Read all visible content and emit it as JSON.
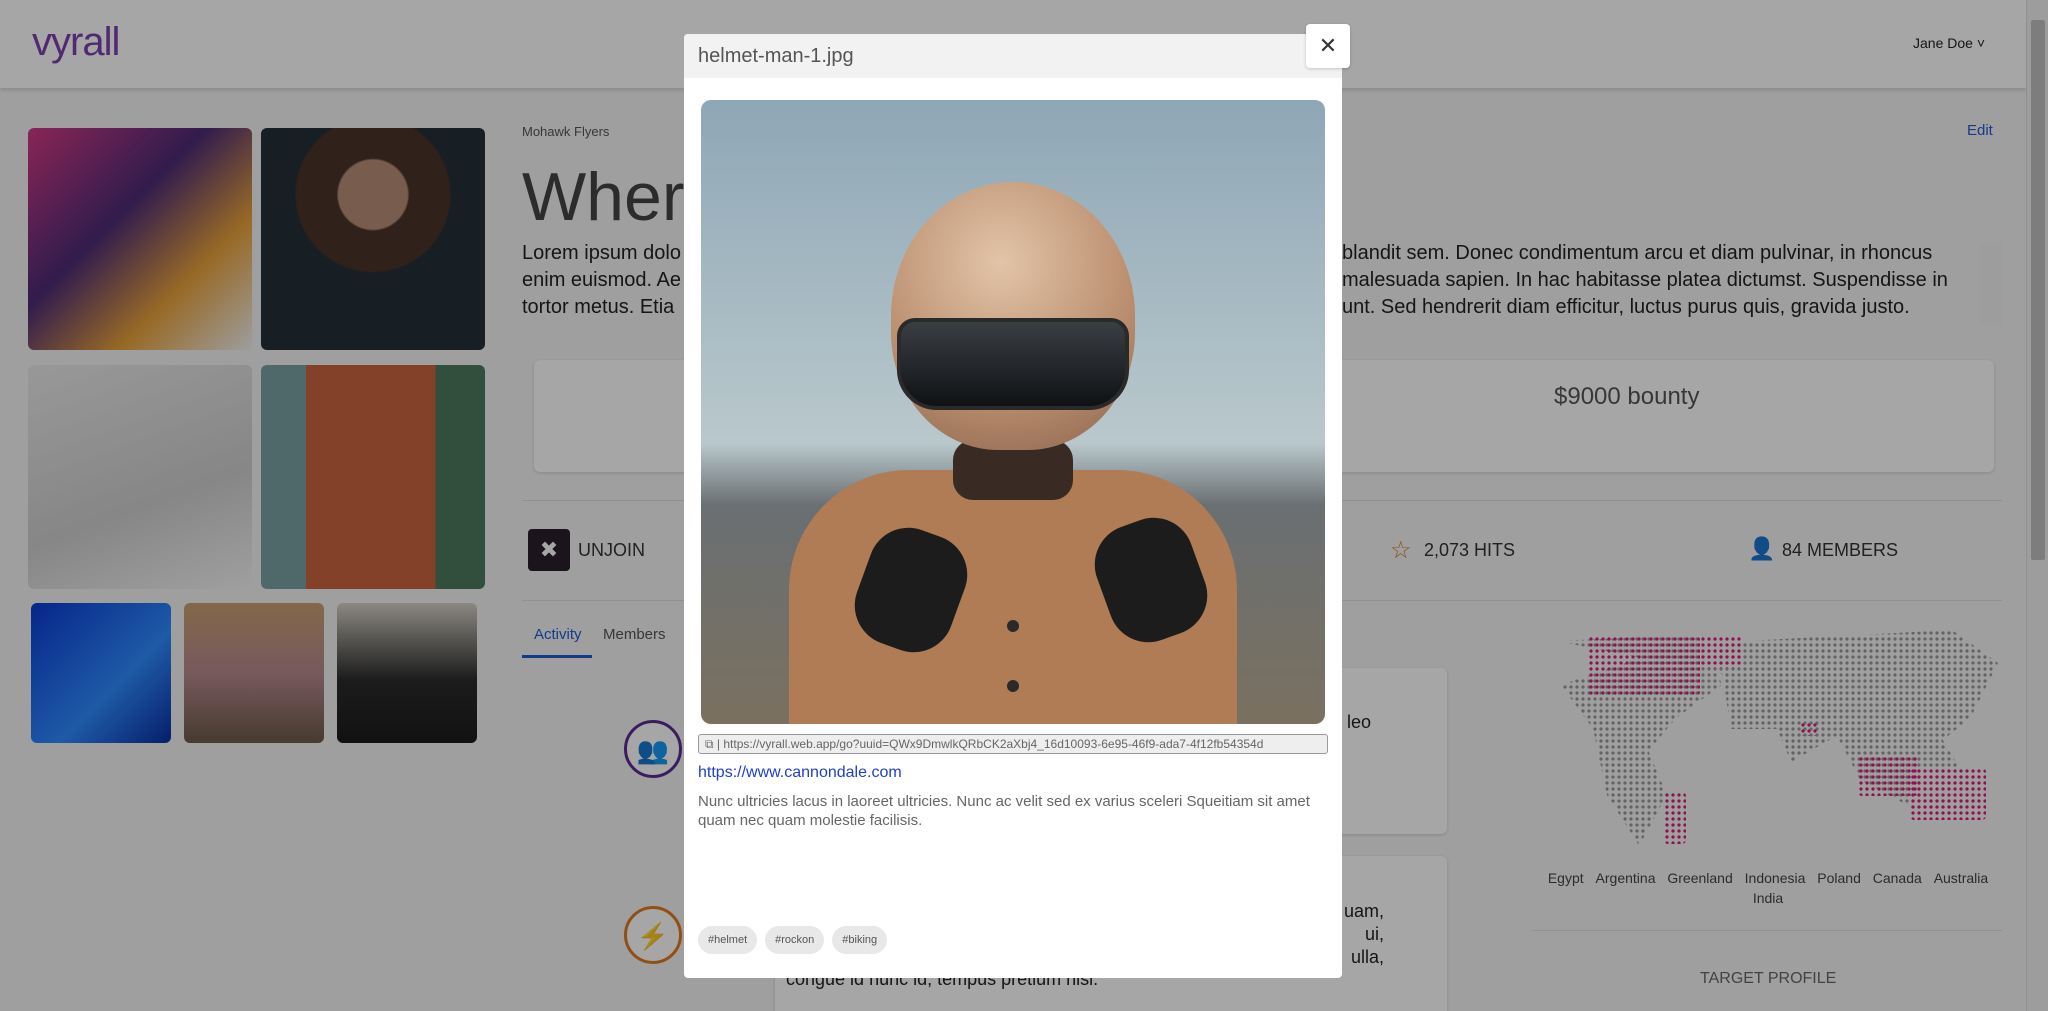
{
  "header": {
    "logo": "vyrall",
    "user": "Jane Doe ˅"
  },
  "page": {
    "breadcrumb": "Mohawk Flyers",
    "edit": "Edit",
    "title": "Where",
    "description_left": "Lorem ipsum dolo\nenim euismod. Ae\ntortor metus. Etia",
    "description_right": "blandit sem. Donec condimentum arcu et diam pulvinar, in rhoncus\nmalesuada sapien. In hac habitasse platea dictumst. Suspendisse in\nunt. Sed hendrerit diam efficitur, luctus purus quis, gravida justo.",
    "bounty": "$9000 bounty"
  },
  "stats": {
    "unjoin": "UNJOIN",
    "hits": "2,073 HITS",
    "members": "84 MEMBERS"
  },
  "tabs": [
    {
      "label": "Activity"
    },
    {
      "label": "Members"
    }
  ],
  "activity": [
    {
      "text": "e leo"
    },
    {
      "text": "uam,\nui,\nulla,",
      "end": "congue id nunc id, tempus pretium nisi."
    }
  ],
  "map": {
    "countries": [
      "Egypt",
      "Argentina",
      "Greenland",
      "Indonesia",
      "Poland",
      "Canada",
      "Australia",
      "India"
    ],
    "highlight_color": "#e0187f"
  },
  "target_profile": "TARGET PROFILE",
  "modal": {
    "title": "helmet-man-1.jpg",
    "url": "| https://vyrall.web.app/go?uuid=QWx9DmwlkQRbCK2aXbj4_16d10093-6e95-46f9-ada7-4f12fb54354d",
    "link": "https://www.cannondale.com",
    "description": "Nunc ultricies lacus in laoreet ultricies. Nunc ac velit sed ex varius sceleri Squeitiam sit amet quam nec quam molestie facilisis.",
    "tags": [
      "#helmet",
      "#rockon",
      "#biking"
    ],
    "close": "✕"
  },
  "icons": {
    "copy": "copy-icon",
    "close": "close-icon",
    "star": "star-icon",
    "person": "person-icon",
    "group": "group-icon",
    "bolt": "bolt-icon"
  }
}
